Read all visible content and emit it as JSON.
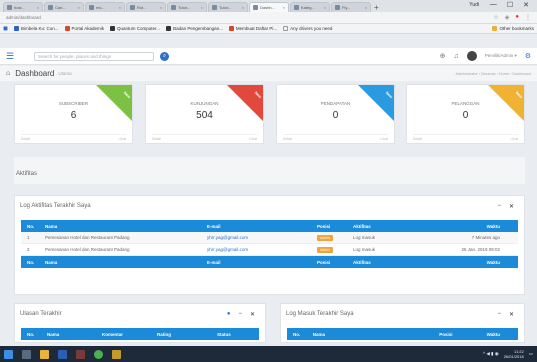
{
  "browser": {
    "tabs": [
      {
        "label": "hosi..."
      },
      {
        "label": "Cari..."
      },
      {
        "label": "ms..."
      },
      {
        "label": "Rot..."
      },
      {
        "label": "Tutor..."
      },
      {
        "label": "Tutor..."
      },
      {
        "label": "Dashb..."
      },
      {
        "label": "Kateg..."
      },
      {
        "label": "Fly..."
      }
    ],
    "active_tab_index": 6,
    "user_chip": "Yudi",
    "window_buttons": [
      "—",
      "☐",
      "✕"
    ],
    "url": "admin/dashboard",
    "bookmarks": [
      {
        "label": "Bimbela Ku: Con...",
        "color": "blue"
      },
      {
        "label": "Portal Akademik",
        "color": "red"
      },
      {
        "label": "Quantum Computer...",
        "color": "dark"
      },
      {
        "label": "Badan Pengembangan...",
        "color": "dark"
      },
      {
        "label": "Membuat Daftar Pi...",
        "color": "red"
      },
      {
        "label": "Any drivers you need",
        "color": "none"
      }
    ],
    "bookmark_right": "Other bookmarks"
  },
  "navbar": {
    "search_placeholder": "Search for people, places and things",
    "user_name": "Pemilik/Admin ▾"
  },
  "page": {
    "title": "Dashboard",
    "subtitle": "Utama",
    "breadcrumb": "Administrator  ›  Beranda  ›  Home  ›  Dashboard"
  },
  "stats": [
    {
      "label": "SUBSCRIBER",
      "value": "6",
      "ribbon": "New",
      "ribbon_color": "#7cc143",
      "foot_left": "Detail",
      "foot_right": "Lihat"
    },
    {
      "label": "KUNJUNGAN",
      "value": "504",
      "ribbon": "New",
      "ribbon_color": "#e2483c",
      "foot_left": "Detail",
      "foot_right": "Lihat"
    },
    {
      "label": "PENDAPATAN",
      "value": "0",
      "ribbon": "New",
      "ribbon_color": "#2a9be0",
      "foot_left": "Detail",
      "foot_right": "Lihat"
    },
    {
      "label": "PELANGGAN",
      "value": "0",
      "ribbon": "New",
      "ribbon_color": "#f0b232",
      "foot_left": "Detail",
      "foot_right": "Lihat"
    }
  ],
  "aktivitas": {
    "title": "Aktifitas"
  },
  "log_panel": {
    "title": "Log Aktifitas Terakhir Saya",
    "columns": [
      "No.",
      "Nama",
      "E-mail",
      "Posisi",
      "Aktifitas",
      "Waktu"
    ],
    "rows": [
      {
        "no": "1",
        "nama": "Pemesanan Hotel dan Restaurant Padang",
        "email": "yhrr.yag@gmail.com",
        "posisi": "Admin",
        "aktifitas": "Log masuk",
        "waktu": "7 Minutes ago"
      },
      {
        "no": "2",
        "nama": "Pemesanan Hotel dan Restaurant Padang",
        "email": "yhrr.yag@gmail.com",
        "posisi": "Admin",
        "aktifitas": "Log masuk",
        "waktu": "25 Jan. 2018 09:02"
      }
    ]
  },
  "ulasan_panel": {
    "title": "Ulasan Terakhir",
    "columns": [
      "No.",
      "Nama",
      "Komentar",
      "Rating",
      "Status"
    ]
  },
  "login_panel": {
    "title": "Log Masuk Terakhir Saya",
    "columns": [
      "No.",
      "Nama",
      "Posisi",
      "Waktu"
    ]
  },
  "taskbar": {
    "time": "11:22",
    "date": "26/01/2018"
  }
}
